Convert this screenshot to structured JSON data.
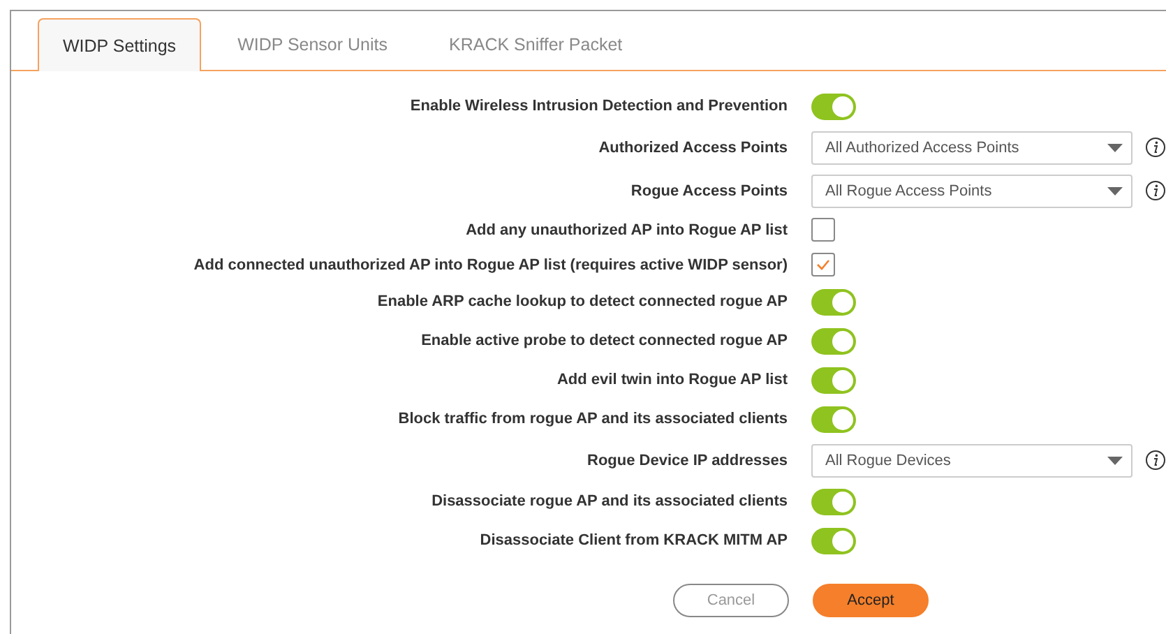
{
  "tabs": [
    {
      "label": "WIDP Settings",
      "selected": true
    },
    {
      "label": "WIDP Sensor Units",
      "selected": false
    },
    {
      "label": "KRACK Sniffer Packet",
      "selected": false
    }
  ],
  "settings": [
    {
      "kind": "toggle",
      "label": "Enable Wireless Intrusion Detection and Prevention",
      "on": true
    },
    {
      "kind": "select",
      "label": "Authorized Access Points",
      "value": "All Authorized Access Points"
    },
    {
      "kind": "select",
      "label": "Rogue Access Points",
      "value": "All Rogue Access Points"
    },
    {
      "kind": "checkbox",
      "label": "Add any unauthorized AP into Rogue AP list",
      "checked": false
    },
    {
      "kind": "checkbox",
      "label": "Add connected unauthorized AP into Rogue AP list (requires active WIDP sensor)",
      "checked": true
    },
    {
      "kind": "toggle",
      "label": "Enable ARP cache lookup to detect connected rogue AP",
      "on": true
    },
    {
      "kind": "toggle",
      "label": "Enable active probe to detect connected rogue AP",
      "on": true
    },
    {
      "kind": "toggle",
      "label": "Add evil twin into Rogue AP list",
      "on": true
    },
    {
      "kind": "toggle",
      "label": "Block traffic from rogue AP and its associated clients",
      "on": true
    },
    {
      "kind": "select",
      "label": "Rogue Device IP addresses",
      "value": "All Rogue Devices"
    },
    {
      "kind": "toggle",
      "label": "Disassociate rogue AP and its associated clients",
      "on": true
    },
    {
      "kind": "toggle",
      "label": "Disassociate Client from KRACK MITM AP",
      "on": true
    }
  ],
  "buttons": {
    "cancel": "Cancel",
    "accept": "Accept"
  }
}
